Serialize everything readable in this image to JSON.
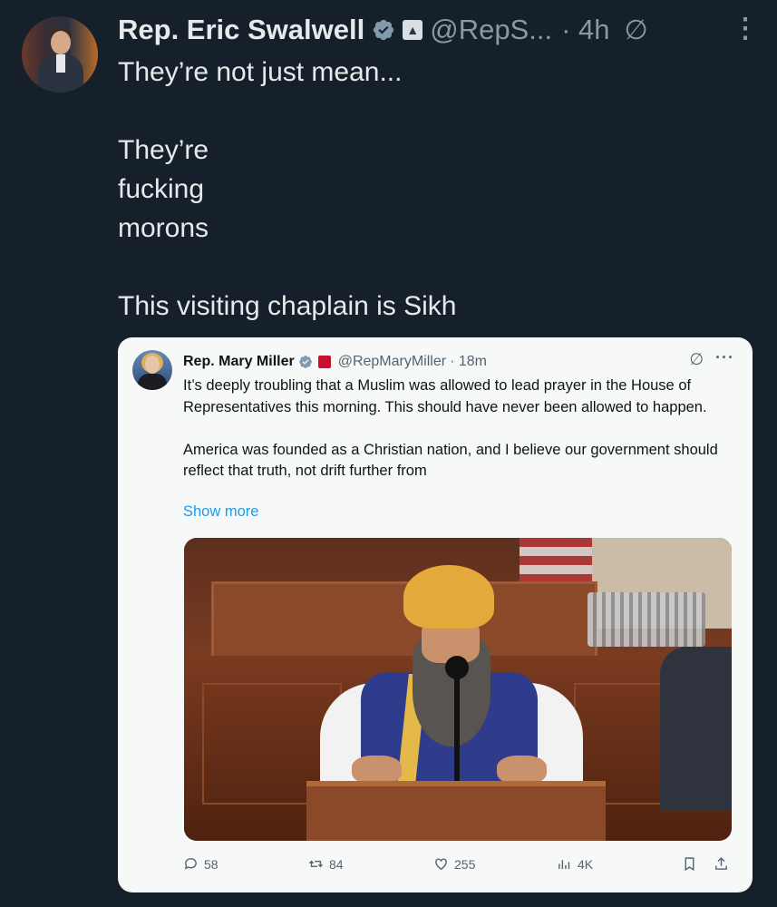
{
  "author": {
    "name": "Rep. Eric Swalwell",
    "handle": "@RepS...",
    "time": "· 4h",
    "gov_badge_icon": "capitol-icon"
  },
  "tweet": {
    "text": "They’re not just mean...\n\nThey’re\nfucking\nmorons\n\nThis visiting chaplain is Sikh"
  },
  "quoted": {
    "name": "Rep. Mary Miller",
    "handle": "@RepMaryMiller",
    "time": "· 18m",
    "text": "It’s deeply troubling that a Muslim was allowed to lead prayer in the House of Representatives this morning. This should have never been allowed to happen.\n\nAmerica was founded as a Christian nation, and I believe our government should reflect that truth, not drift further from",
    "show_more": "Show more",
    "stats": {
      "replies": "58",
      "reposts": "84",
      "likes": "255",
      "views": "4K"
    }
  },
  "colors": {
    "background": "#15202b",
    "accent": "#1d9bf0",
    "muted": "#8b98a5"
  }
}
